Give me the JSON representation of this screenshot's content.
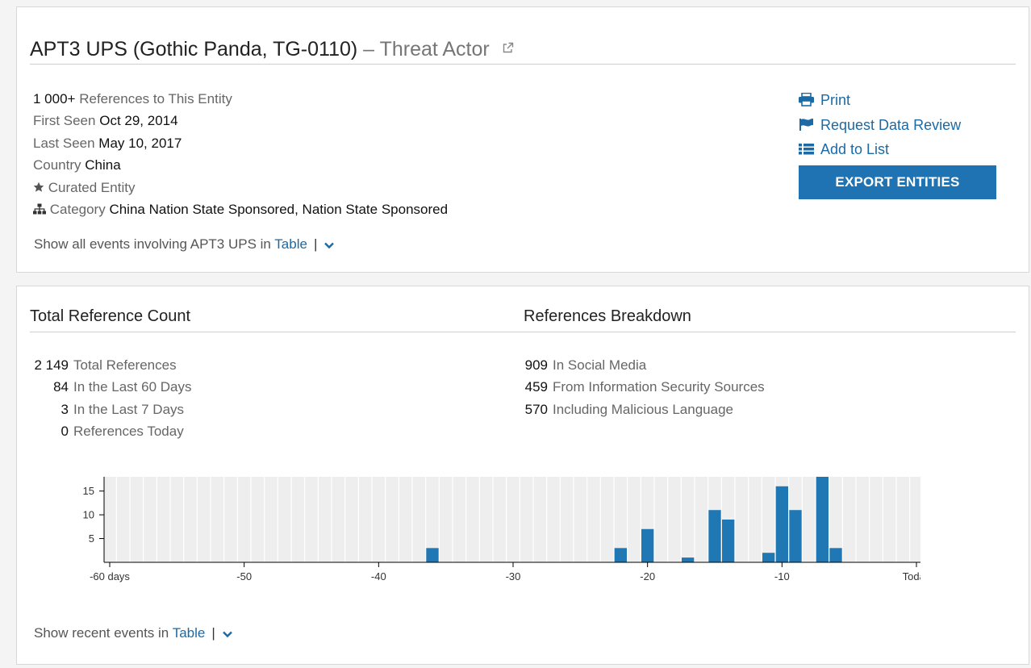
{
  "entity": {
    "name": "APT3 UPS (Gothic Panda, TG-0110)",
    "dash": "–",
    "type": "Threat Actor",
    "references_count": "1 000+",
    "references_label": "References to This Entity",
    "first_seen_label": "First Seen",
    "first_seen": "Oct 29, 2014",
    "last_seen_label": "Last Seen",
    "last_seen": "May 10, 2017",
    "country_label": "Country",
    "country": "China",
    "curated_label": "Curated Entity",
    "category_label": "Category",
    "category": "China Nation State Sponsored, Nation State Sponsored",
    "show_events_prefix": "Show all events involving APT3 UPS in",
    "show_events_link": "Table",
    "separator": "|"
  },
  "actions": {
    "print": "Print",
    "request_review": "Request Data Review",
    "add_to_list": "Add to List",
    "export": "EXPORT ENTITIES"
  },
  "total": {
    "title": "Total Reference Count",
    "rows": [
      {
        "num": "2 149",
        "label": "Total References"
      },
      {
        "num": "84",
        "label": "In the Last 60 Days"
      },
      {
        "num": "3",
        "label": "In the Last 7 Days"
      },
      {
        "num": "0",
        "label": "References Today"
      }
    ]
  },
  "breakdown": {
    "title": "References Breakdown",
    "rows": [
      {
        "num": "909",
        "label": "In Social Media"
      },
      {
        "num": "459",
        "label": "From Information Security Sources"
      },
      {
        "num": "570",
        "label": "Including Malicious Language"
      }
    ]
  },
  "recent": {
    "prefix": "Show recent events in",
    "link": "Table",
    "separator": "|"
  },
  "colors": {
    "accent": "#1f73b3",
    "link": "#1b6aa5",
    "bar": "#1f77b4",
    "plot_bg": "#eeeeee"
  },
  "chart_data": {
    "type": "bar",
    "xlabel": "",
    "ylabel": "",
    "xlim": [
      -60,
      0
    ],
    "ylim": [
      0,
      18
    ],
    "x_ticks": [
      -60,
      -50,
      -40,
      -30,
      -20,
      -10,
      0
    ],
    "x_tick_labels": [
      "-60 days",
      "-50",
      "-40",
      "-30",
      "-20",
      "-10",
      "Today"
    ],
    "y_ticks": [
      5,
      10,
      15
    ],
    "y_tick_labels": [
      "5",
      "10",
      "15"
    ],
    "grid": true,
    "series": [
      {
        "x": [
          -36,
          -22,
          -20,
          -17,
          -15,
          -14,
          -11,
          -10,
          -9,
          -7,
          -6
        ],
        "values": [
          3,
          3,
          7,
          1,
          11,
          9,
          2,
          16,
          11,
          18,
          3
        ]
      }
    ]
  }
}
